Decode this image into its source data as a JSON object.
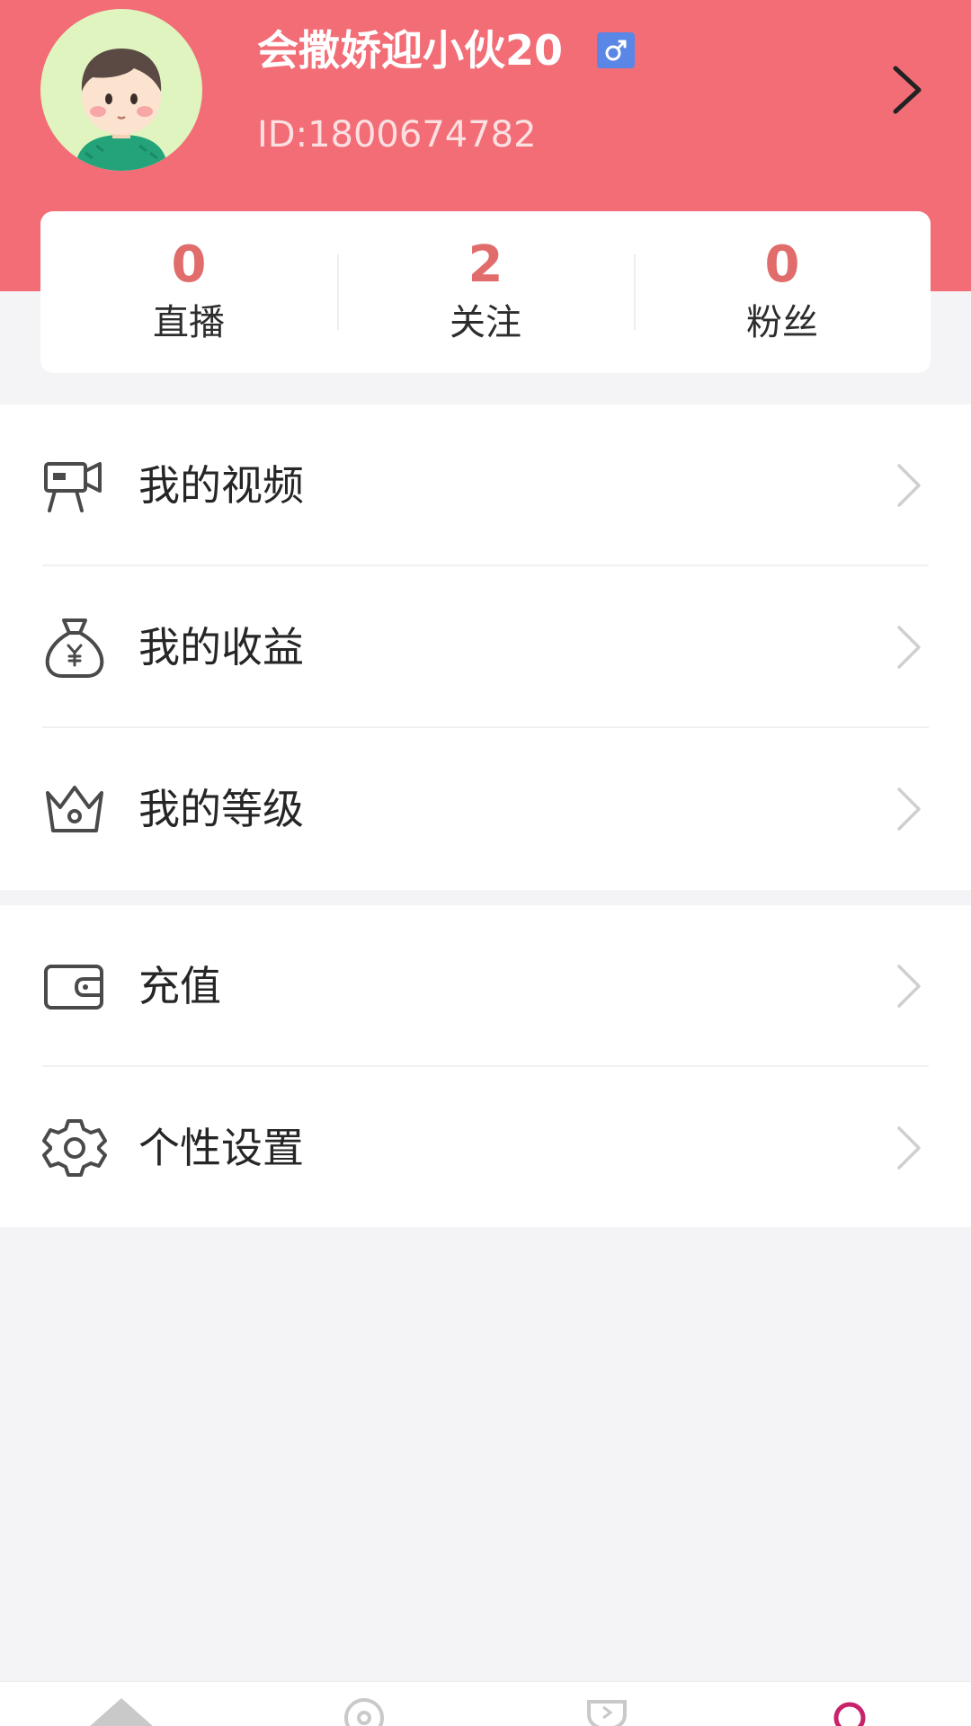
{
  "profile": {
    "username": "会撒娇迎小伙20",
    "user_id": "ID:1800674782",
    "gender": "male",
    "gender_symbol": "♂"
  },
  "stats": [
    {
      "count": "0",
      "label": "直播"
    },
    {
      "count": "2",
      "label": "关注"
    },
    {
      "count": "0",
      "label": "粉丝"
    }
  ],
  "menu_group_1": [
    {
      "label": "我的视频",
      "icon": "video-camera-icon"
    },
    {
      "label": "我的收益",
      "icon": "money-bag-icon"
    },
    {
      "label": "我的等级",
      "icon": "crown-icon"
    }
  ],
  "menu_group_2": [
    {
      "label": "充值",
      "icon": "wallet-icon"
    },
    {
      "label": "个性设置",
      "icon": "gear-icon"
    }
  ],
  "tabbar": [
    {
      "icon": "home-icon"
    },
    {
      "icon": "explore-icon"
    },
    {
      "icon": "trophy-icon"
    },
    {
      "icon": "profile-icon",
      "active": true
    }
  ],
  "colors": {
    "header": "#f26d76",
    "accent_count": "#e06c6b",
    "gender_badge": "#5a86e6",
    "active_tab": "#c8226a",
    "background": "#f4f3f6"
  }
}
